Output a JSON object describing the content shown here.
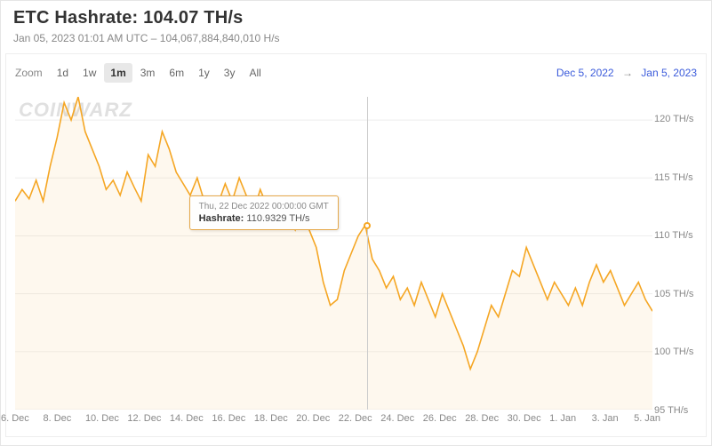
{
  "header": {
    "title": "ETC Hashrate: 104.07 TH/s",
    "subtitle": "Jan 05, 2023 01:01 AM UTC  –  104,067,884,840,010 H/s"
  },
  "toolbar": {
    "zoom_label": "Zoom",
    "buttons": {
      "d1": "1d",
      "w1": "1w",
      "m1": "1m",
      "m3": "3m",
      "m6": "6m",
      "y1": "1y",
      "y3": "3y",
      "all": "All"
    },
    "active": "m1",
    "range_from": "Dec 5, 2022",
    "range_to": "Jan 5, 2023",
    "arrow": "→"
  },
  "watermark": "CoinWarz",
  "tooltip": {
    "date": "Thu, 22 Dec 2022 00:00:00 GMT",
    "label": "Hashrate:",
    "value": "110.9329 TH/s",
    "index": 50
  },
  "chart_data": {
    "type": "line",
    "title": "ETC Hashrate",
    "xlabel": "",
    "ylabel": "",
    "ylim": [
      95,
      122
    ],
    "y_ticks": [
      {
        "v": 95,
        "label": "95 TH/s"
      },
      {
        "v": 100,
        "label": "100 TH/s"
      },
      {
        "v": 105,
        "label": "105 TH/s"
      },
      {
        "v": 110,
        "label": "110 TH/s"
      },
      {
        "v": 115,
        "label": "115 TH/s"
      },
      {
        "v": 120,
        "label": "120 TH/s"
      }
    ],
    "x_ticks": [
      {
        "i": 0,
        "label": "6. Dec"
      },
      {
        "i": 6,
        "label": "8. Dec"
      },
      {
        "i": 12,
        "label": "10. Dec"
      },
      {
        "i": 18,
        "label": "12. Dec"
      },
      {
        "i": 24,
        "label": "14. Dec"
      },
      {
        "i": 30,
        "label": "16. Dec"
      },
      {
        "i": 36,
        "label": "18. Dec"
      },
      {
        "i": 42,
        "label": "20. Dec"
      },
      {
        "i": 48,
        "label": "22. Dec"
      },
      {
        "i": 54,
        "label": "24. Dec"
      },
      {
        "i": 60,
        "label": "26. Dec"
      },
      {
        "i": 66,
        "label": "28. Dec"
      },
      {
        "i": 72,
        "label": "30. Dec"
      },
      {
        "i": 78,
        "label": "1. Jan"
      },
      {
        "i": 84,
        "label": "3. Jan"
      },
      {
        "i": 90,
        "label": "5. Jan"
      }
    ],
    "series": [
      {
        "name": "Hashrate",
        "values": [
          113.0,
          114.0,
          113.2,
          114.8,
          113.0,
          116.0,
          118.5,
          121.5,
          120.0,
          122.0,
          119.0,
          117.5,
          116.0,
          114.0,
          114.8,
          113.5,
          115.5,
          114.2,
          113.0,
          117.0,
          116.0,
          119.0,
          117.5,
          115.5,
          114.5,
          113.5,
          115.0,
          113.0,
          111.5,
          112.8,
          114.5,
          113.0,
          115.0,
          113.5,
          112.0,
          114.0,
          112.5,
          111.0,
          113.0,
          111.8,
          110.5,
          112.0,
          110.5,
          109.0,
          106.0,
          104.0,
          104.5,
          107.0,
          108.5,
          110.0,
          110.93,
          108.0,
          107.0,
          105.5,
          106.5,
          104.5,
          105.5,
          104.0,
          106.0,
          104.5,
          103.0,
          105.0,
          103.5,
          102.0,
          100.5,
          98.5,
          100.0,
          102.0,
          104.0,
          103.0,
          105.0,
          107.0,
          106.5,
          109.0,
          107.5,
          106.0,
          104.5,
          106.0,
          105.0,
          104.0,
          105.5,
          104.0,
          106.0,
          107.5,
          106.0,
          107.0,
          105.5,
          104.0,
          105.0,
          106.0,
          104.5,
          103.5
        ]
      }
    ]
  }
}
